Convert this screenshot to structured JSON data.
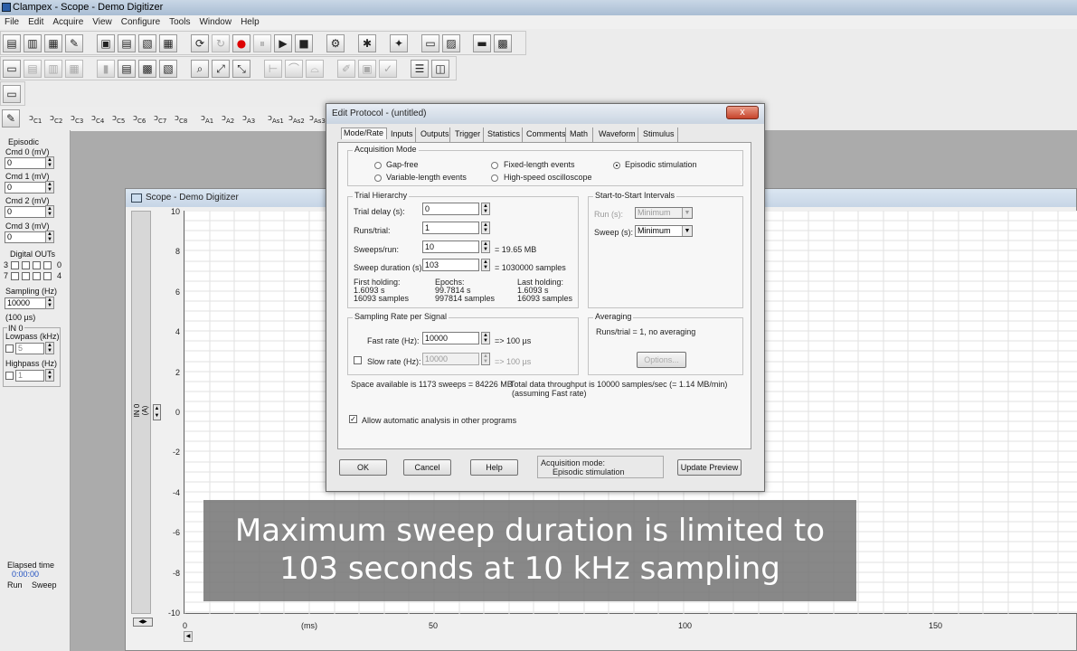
{
  "app": {
    "title": "Clampex - Scope - Demo Digitizer"
  },
  "menu": [
    "File",
    "Edit",
    "Acquire",
    "View",
    "Configure",
    "Tools",
    "Window",
    "Help"
  ],
  "signals": [
    "C1",
    "C2",
    "C3",
    "C4",
    "C5",
    "C6",
    "C7",
    "C8",
    "A1",
    "A2",
    "A3",
    "As1",
    "As2",
    "As3"
  ],
  "left_panel": {
    "mode": "Episodic",
    "cmd0_label": "Cmd 0 (mV)",
    "cmd0": "0",
    "cmd1_label": "Cmd 1 (mV)",
    "cmd1": "0",
    "cmd2_label": "Cmd 2 (mV)",
    "cmd2": "0",
    "cmd3_label": "Cmd 3 (mV)",
    "cmd3": "0",
    "digital_label": "Digital OUTs",
    "dig_hi": "3",
    "dig_hi_end": "0",
    "dig_lo": "7",
    "dig_lo_end": "4",
    "sampling_label": "Sampling (Hz)",
    "sampling": "10000",
    "sampling_us": "(100 µs)",
    "in0": "IN 0",
    "lowpass_label": "Lowpass (kHz)",
    "lowpass": "5",
    "highpass_label": "Highpass (Hz)",
    "highpass": "1",
    "elapsed_label": "Elapsed time",
    "elapsed": "0:00:00",
    "run": "Run",
    "sweep": "Sweep"
  },
  "scope": {
    "title": "Scope - Demo Digitizer",
    "channel_label": "IN 0 (A)",
    "y_ticks": [
      "10",
      "8",
      "6",
      "4",
      "2",
      "0",
      "-2",
      "-4",
      "-6",
      "-8",
      "-10"
    ],
    "x_ticks": [
      "0",
      "50",
      "100",
      "150"
    ],
    "x_unit": "(ms)"
  },
  "dialog": {
    "title": "Edit Protocol - (untitled)",
    "close": "x",
    "tabs": [
      "Mode/Rate",
      "Inputs",
      "Outputs",
      "Trigger",
      "Statistics",
      "Comments",
      "Math",
      "Waveform",
      "Stimulus"
    ],
    "acq_mode_title": "Acquisition Mode",
    "mode_gapfree": "Gap-free",
    "mode_variable": "Variable-length events",
    "mode_fixed": "Fixed-length events",
    "mode_highspeed": "High-speed oscilloscope",
    "mode_episodic": "Episodic stimulation",
    "trial_title": "Trial Hierarchy",
    "trial_delay_label": "Trial delay (s):",
    "trial_delay": "0",
    "runs_label": "Runs/trial:",
    "runs": "1",
    "sweeps_label": "Sweeps/run:",
    "sweeps": "10",
    "sweeps_size": "= 19.65 MB",
    "sweep_dur_label": "Sweep duration (s):",
    "sweep_dur": "103",
    "sweep_dur_samples": "= 1030000 samples",
    "first_holding_label": "First holding:",
    "first_holding_s": "1.6093 s",
    "first_holding_n": "16093 samples",
    "epochs_label": "Epochs:",
    "epochs_s": "99.7814 s",
    "epochs_n": "997814 samples",
    "last_holding_label": "Last holding:",
    "last_holding_s": "1.6093 s",
    "last_holding_n": "16093 samples",
    "s2s_title": "Start-to-Start Intervals",
    "run_s_label": "Run (s):",
    "run_s": "Minimum",
    "sweep_s_label": "Sweep (s):",
    "sweep_s": "Minimum",
    "rate_title": "Sampling Rate per Signal",
    "fast_label": "Fast rate  (Hz):",
    "fast": "10000",
    "fast_us": "=> 100 µs",
    "slow_label": "Slow rate (Hz):",
    "slow": "10000",
    "slow_us": "=> 100 µs",
    "avg_title": "Averaging",
    "avg_text": "Runs/trial = 1, no averaging",
    "options": "Options...",
    "space": "Space available is 1173 sweeps = 84226 MB",
    "throughput": "Total data throughput is 10000 samples/sec (= 1.14 MB/min)",
    "throughput2": "(assuming Fast rate)",
    "auto_analysis": "Allow automatic analysis in other programs",
    "ok": "OK",
    "cancel": "Cancel",
    "help": "Help",
    "acq_mode_label": "Acquisition mode:",
    "acq_mode_value": "Episodic stimulation",
    "update_preview": "Update Preview"
  },
  "caption": {
    "line1": "Maximum sweep duration is limited to",
    "line2": "103 seconds at 10 kHz sampling"
  }
}
